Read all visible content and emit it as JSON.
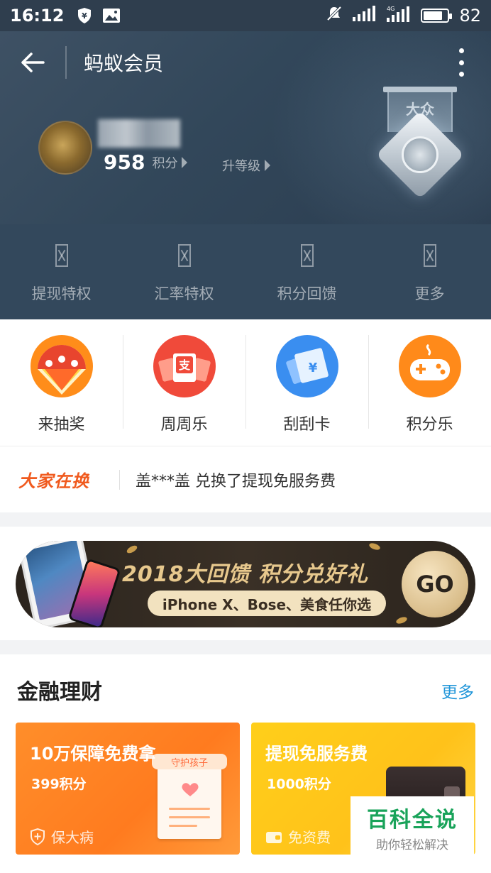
{
  "status_bar": {
    "time": "16:12",
    "battery": "82",
    "battery_level": 0.82,
    "network": "4G"
  },
  "header": {
    "title": "蚂蚁会员",
    "points_value": "958",
    "points_unit": "积分",
    "upgrade_label": "升等级",
    "medal_label": "大众"
  },
  "privileges": [
    {
      "label": "提现特权"
    },
    {
      "label": "汇率特权"
    },
    {
      "label": "积分回馈"
    },
    {
      "label": "更多"
    }
  ],
  "games": [
    {
      "label": "来抽奖",
      "color": "#ff8d1a"
    },
    {
      "label": "周周乐",
      "color": "#f04a3a"
    },
    {
      "label": "刮刮卡",
      "color": "#3a8ef0"
    },
    {
      "label": "积分乐",
      "color": "#ff8a1a"
    }
  ],
  "ticker": {
    "tag": "大家在换",
    "text": "盖***盖 兑换了提现免服务费"
  },
  "banner": {
    "title": "2018大回馈 积分兑好礼",
    "subtitle": "iPhone X、Bose、美食任你选",
    "go": "GO"
  },
  "finance": {
    "title": "金融理财",
    "more": "更多",
    "cards": [
      {
        "title": "10万保障免费拿",
        "sub": "399积分",
        "tag": "保大病",
        "doc_label": "守护孩子"
      },
      {
        "title": "提现免服务费",
        "sub": "1000积分",
        "tag": "免资费"
      }
    ]
  },
  "watermark": {
    "line1": "百科全说",
    "line2": "助你轻松解决"
  }
}
